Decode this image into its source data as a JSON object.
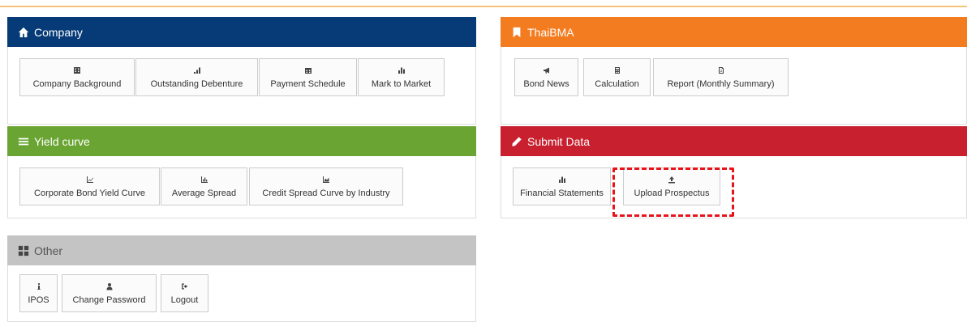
{
  "colors": {
    "company": "#063b77",
    "thaibma": "#f47c20",
    "yield": "#6aa533",
    "submit": "#c8202e",
    "other": "#c4c4c4",
    "highlight": "#e8131b"
  },
  "company": {
    "title": "Company",
    "icon": "home-icon",
    "buttons": [
      {
        "label": "Company Background",
        "icon": "building-icon"
      },
      {
        "label": "Outstanding Debenture",
        "icon": "signal-icon"
      },
      {
        "label": "Payment Schedule",
        "icon": "calendar-icon"
      },
      {
        "label": "Mark to Market",
        "icon": "bar-chart-icon"
      }
    ]
  },
  "thaibma": {
    "title": "ThaiBMA",
    "icon": "bookmark-icon",
    "buttons": [
      {
        "label": "Bond News",
        "icon": "bullhorn-icon"
      },
      {
        "label": "Calculation",
        "icon": "calculator-icon"
      },
      {
        "label": "Report (Monthly Summary)",
        "icon": "file-icon"
      }
    ]
  },
  "yield": {
    "title": "Yield curve",
    "icon": "list-icon",
    "buttons": [
      {
        "label": "Corporate Bond Yield Curve",
        "icon": "line-chart-icon"
      },
      {
        "label": "Average Spread",
        "icon": "bar-chart-icon"
      },
      {
        "label": "Credit Spread Curve by Industry",
        "icon": "area-chart-icon"
      }
    ]
  },
  "submit": {
    "title": "Submit Data",
    "icon": "pencil-icon",
    "buttons": [
      {
        "label": "Financial Statements",
        "icon": "bar-chart-icon"
      },
      {
        "label": "Upload Prospectus",
        "icon": "upload-icon"
      }
    ]
  },
  "other": {
    "title": "Other",
    "icon": "grid-icon",
    "buttons": [
      {
        "label": "IPOS",
        "icon": "info-icon"
      },
      {
        "label": "Change Password",
        "icon": "user-icon"
      },
      {
        "label": "Logout",
        "icon": "sign-out-icon"
      }
    ]
  }
}
